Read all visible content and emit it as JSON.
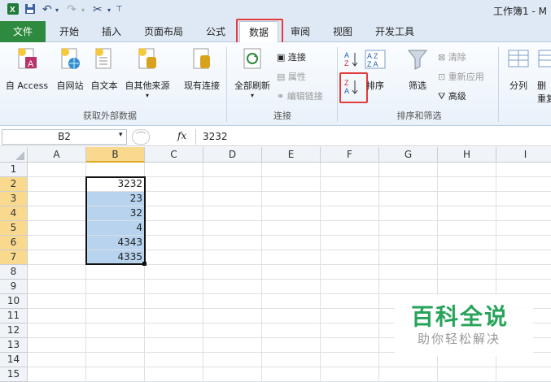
{
  "window": {
    "title": "工作簿1 - M"
  },
  "quick_access": [
    "save-icon",
    "undo-icon",
    "redo-icon",
    "tools-icon",
    "customize-icon"
  ],
  "tabs": [
    {
      "label": "文件"
    },
    {
      "label": "开始"
    },
    {
      "label": "插入"
    },
    {
      "label": "页面布局"
    },
    {
      "label": "公式"
    },
    {
      "label": "数据"
    },
    {
      "label": "审阅"
    },
    {
      "label": "视图"
    },
    {
      "label": "开发工具"
    }
  ],
  "ribbon": {
    "external": {
      "access": "自 Access",
      "web": "自网站",
      "text": "自文本",
      "other": "自其他来源",
      "existing": "现有连接",
      "group": "获取外部数据"
    },
    "connections": {
      "refresh": "全部刷新",
      "connect": "连接",
      "props": "属性",
      "edit_links": "编辑链接",
      "group": "连接"
    },
    "sort": {
      "sort": "排序",
      "filter": "筛选",
      "clear": "清除",
      "reapply": "重新应用",
      "advanced": "高级",
      "group": "排序和筛选"
    },
    "tools": {
      "split": "分列",
      "del": "删",
      "dup": "重复"
    }
  },
  "formula_bar": {
    "name_box": "B2",
    "fx": "fx",
    "value": "3232"
  },
  "columns": [
    "A",
    "B",
    "C",
    "D",
    "E",
    "F",
    "G",
    "H",
    "I"
  ],
  "rows": [
    "1",
    "2",
    "3",
    "4",
    "5",
    "6",
    "7",
    "8",
    "9",
    "10",
    "11",
    "12",
    "13",
    "14",
    "15"
  ],
  "cells": {
    "B2": "3232",
    "B3": "23",
    "B4": "32",
    "B5": "4",
    "B6": "4343",
    "B7": "4335"
  },
  "watermark": {
    "title": "百科全说",
    "subtitle": "助你轻松解决"
  },
  "colors": {
    "file_tab": "#2e8a3e",
    "highlight": "#e23b3b",
    "selection": "#b7d3ee"
  }
}
